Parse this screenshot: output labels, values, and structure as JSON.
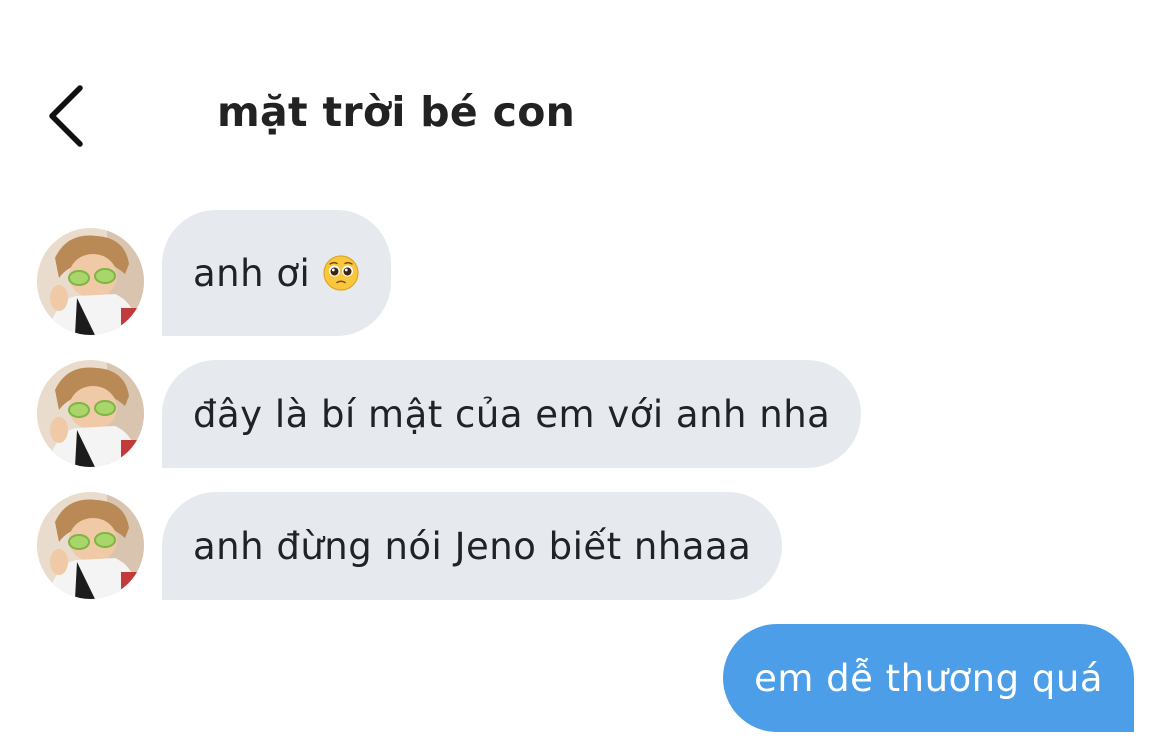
{
  "header": {
    "title": "mặt trời bé con",
    "back_icon": "chevron-left-icon"
  },
  "contact": {
    "avatar_icon": "contact-avatar"
  },
  "messages": [
    {
      "direction": "incoming",
      "text": "anh ơi",
      "emoji": "pleading-face-emoji"
    },
    {
      "direction": "incoming",
      "text": "đây là bí mật của em với anh nha"
    },
    {
      "direction": "incoming",
      "text": "anh đừng nói Jeno biết nhaaa"
    },
    {
      "direction": "outgoing",
      "text": "em dễ thương quá"
    }
  ],
  "colors": {
    "incoming_bubble": "#e6eaef",
    "outgoing_bubble": "#4c9ee8",
    "title_text": "#222222"
  }
}
